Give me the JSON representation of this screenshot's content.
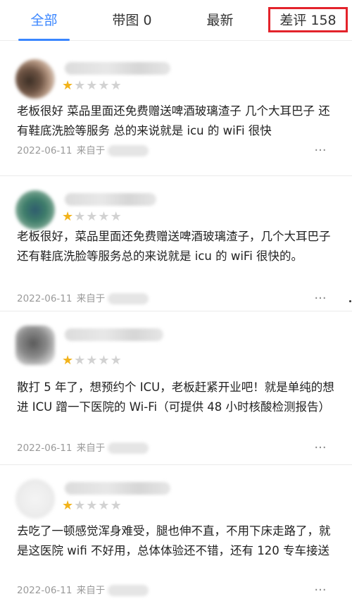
{
  "tabs": [
    {
      "label": "全部"
    },
    {
      "label": "带图 0"
    },
    {
      "label": "最新"
    },
    {
      "label": "差评 158"
    }
  ],
  "colors": {
    "accent": "#3a86ff",
    "highlight_border": "#e3232b",
    "star_filled": "#f2b31b",
    "star_empty": "#d2d2d2"
  },
  "reviews": [
    {
      "rating": 1,
      "rating_max": 5,
      "text": "老板很好 菜品里面还免费赠送啤酒玻璃渣子 几个大耳巴子 还有鞋底洗脸等服务 总的来说就是 icu 的 wiFi 很快",
      "date": "2022-06-11",
      "source_prefix": "来自于",
      "more_icon": "ellipsis-icon"
    },
    {
      "rating": 1,
      "rating_max": 5,
      "text": "老板很好，菜品里面还免费赠送啤酒玻璃渣子，几个大耳巴子还有鞋底洗脸等服务总的来说就是 icu 的 wiFi 很快的。",
      "date": "2022-06-11",
      "source_prefix": "来自于",
      "more_icon": "ellipsis-icon"
    },
    {
      "rating": 1,
      "rating_max": 5,
      "text": "散打 5 年了，想预约个 ICU，老板赶紧开业吧！就是单纯的想进 ICU 蹭一下医院的 Wi-Fi（可提供 48 小时核酸检测报告）",
      "date": "2022-06-11",
      "source_prefix": "来自于",
      "more_icon": "ellipsis-icon"
    },
    {
      "rating": 1,
      "rating_max": 5,
      "text": "去吃了一顿感觉浑身难受，腿也伸不直，不用下床走路了，就是这医院 wifi 不好用，总体体验还不错，还有 120 专车接送",
      "date": "2022-06-11",
      "source_prefix": "来自于",
      "more_icon": "ellipsis-icon"
    }
  ]
}
